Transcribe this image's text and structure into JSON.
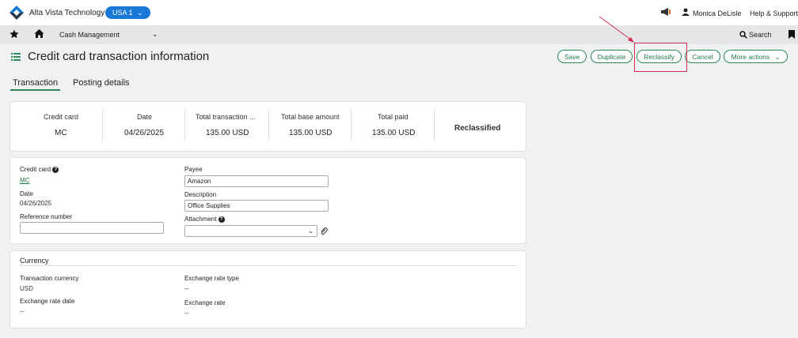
{
  "header": {
    "company": "Alta Vista Technology",
    "entity": "USA 1",
    "user": "Monica DeLisle",
    "help": "Help & Support"
  },
  "nav": {
    "module": "Cash Management",
    "search": "Search"
  },
  "page": {
    "title": "Credit card transaction information"
  },
  "actions": {
    "save": "Save",
    "duplicate": "Duplicate",
    "reclassify": "Reclassify",
    "cancel": "Cancel",
    "more": "More actions"
  },
  "tabs": [
    "Transaction",
    "Posting details"
  ],
  "summary": {
    "credit_card_label": "Credit card",
    "credit_card_value": "MC",
    "date_label": "Date",
    "date_value": "04/26/2025",
    "total_txn_label": "Total transaction ...",
    "total_txn_value": "135.00 USD",
    "total_base_label": "Total base amount",
    "total_base_value": "135.00 USD",
    "total_paid_label": "Total paid",
    "total_paid_value": "135.00 USD",
    "status": "Reclassified"
  },
  "details": {
    "credit_card_label": "Credit card",
    "credit_card_value": "MC",
    "date_label": "Date",
    "date_value": "04/26/2025",
    "reference_label": "Reference number",
    "reference_value": "",
    "payee_label": "Payee",
    "payee_value": "Amazon",
    "description_label": "Description",
    "description_value": "Office Supplies",
    "attachment_label": "Attachment",
    "attachment_value": ""
  },
  "currency": {
    "title": "Currency",
    "txn_currency_label": "Transaction currency",
    "txn_currency_value": "USD",
    "rate_date_label": "Exchange rate date",
    "rate_date_value": "--",
    "rate_type_label": "Exchange rate type",
    "rate_type_value": "--",
    "rate_label": "Exchange rate",
    "rate_value": "--"
  },
  "colors": {
    "accent_green": "#2d8a57",
    "entity_blue": "#1a78d6",
    "highlight_red": "#d03050"
  }
}
